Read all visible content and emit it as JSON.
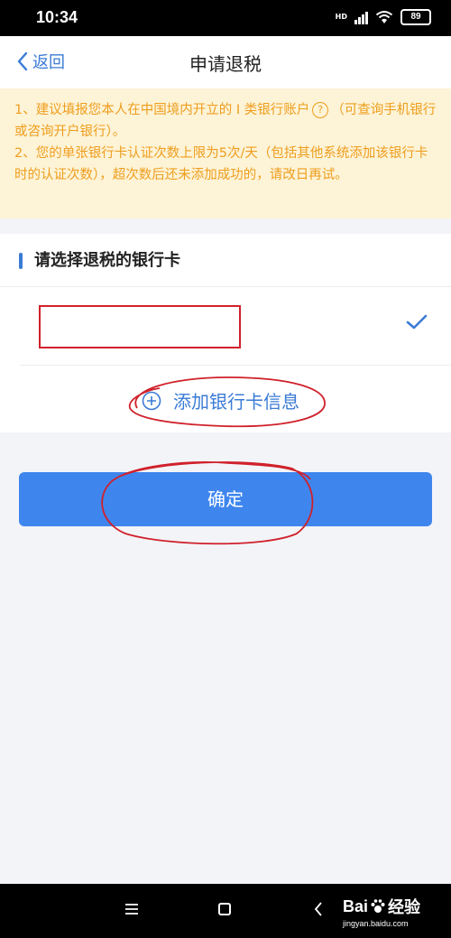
{
  "status_bar": {
    "time": "10:34",
    "network_label": "HD",
    "battery": "89"
  },
  "nav": {
    "back_label": "返回",
    "title": "申请退税"
  },
  "notice": {
    "line1_a": "1、建议填报您本人在中国境内开立的 I 类银行账户",
    "help_icon": "?",
    "line1_b": "（可查询手机银行或咨询开户银行）。",
    "line2": "2、您的单张银行卡认证次数上限为5次/天（包括其他系统添加该银行卡时的认证次数），超次数后还未添加成功的，请改日再试。"
  },
  "section": {
    "title": "请选择退税的银行卡"
  },
  "add_card": {
    "label": "添加银行卡信息"
  },
  "confirm": {
    "label": "确定"
  },
  "watermark": {
    "brand": "Bai",
    "brand_suffix": "经验",
    "url": "jingyan.baidu.com"
  },
  "colors": {
    "accent": "#3a7bd5",
    "button": "#3e86ee",
    "notice_bg": "#fdf3d6",
    "notice_text": "#ee9e1e",
    "annotation_red": "#d0212b"
  },
  "icons": [
    "back-chevron-icon",
    "help-icon",
    "check-icon",
    "plus-circle-icon",
    "menu-icon",
    "home-icon",
    "nav-back-icon",
    "wifi-icon",
    "signal-icon"
  ]
}
